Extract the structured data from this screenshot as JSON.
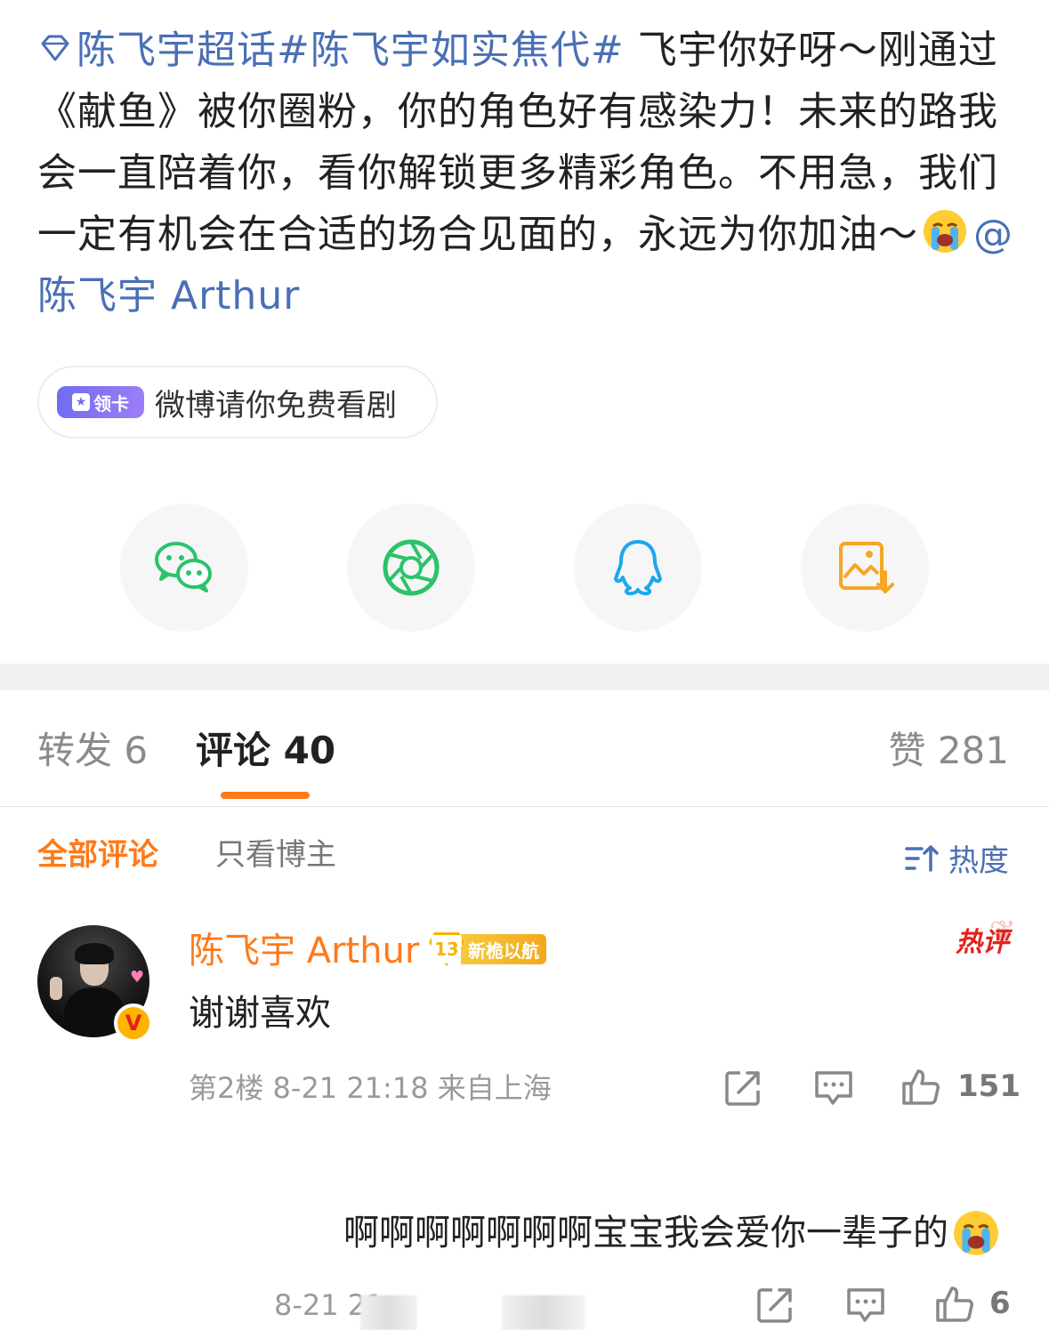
{
  "post": {
    "topic1": "陈飞宇超话",
    "topic2": "#陈飞宇如实焦代#",
    "text1": " 飞宇你好呀～刚通过《献鱼》被你圈粉，你的角色好有感染力！未来的路我会一直陪着你，看你解锁更多精彩角色。不用急，我们一定有机会在合适的场合见面的，永远为你加油～",
    "mention": "@陈飞宇 Arthur",
    "emoji": "loudly-crying-face"
  },
  "chip": {
    "badge_label": "领卡",
    "text": "微博请你免费看剧"
  },
  "share": [
    {
      "name": "wechat",
      "color": "#2bc36a"
    },
    {
      "name": "moments",
      "color": "#2bc36a"
    },
    {
      "name": "qq",
      "color": "#1aa7f0"
    },
    {
      "name": "save-image",
      "color": "#f5a623"
    }
  ],
  "tabs": {
    "repost_label": "转发 6",
    "comment_label": "评论 40",
    "like_label": "赞 281",
    "active": "comment",
    "accent": "#ff7a1a"
  },
  "filters": {
    "all": "全部评论",
    "owner_only": "只看博主",
    "sort": "热度"
  },
  "comments": [
    {
      "user": "陈飞宇 Arthur",
      "level": "13",
      "level_title": "新桅以航",
      "verified": "V",
      "hot_tag": "热评",
      "text": "谢谢喜欢",
      "meta": "第2楼  8-21 21:18  来自上海",
      "likes": "151"
    },
    {
      "text": "啊啊啊啊啊啊啊宝宝我会爱你一辈子的",
      "emoji": "loudly-crying-face",
      "meta": "8-21 21",
      "likes": "6"
    }
  ]
}
